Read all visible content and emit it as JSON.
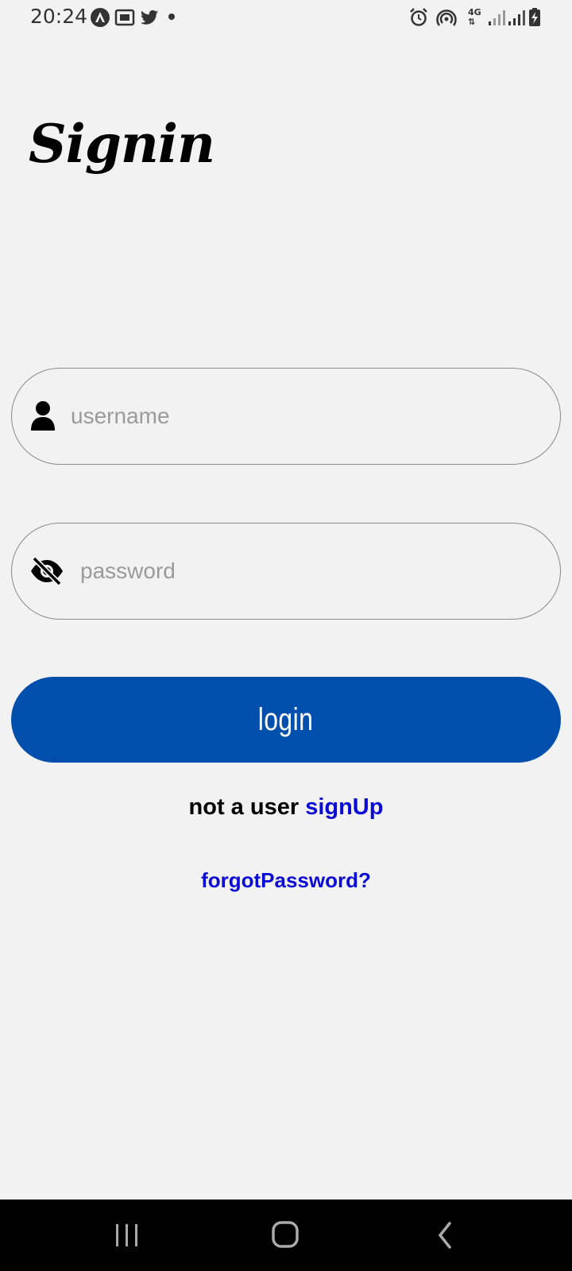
{
  "status_bar": {
    "time": "20:24",
    "left_icons": [
      "nav-app-icon",
      "cast-icon",
      "twitter-icon",
      "notification-dot"
    ],
    "right_icons": [
      "alarm-icon",
      "hotspot-icon",
      "4g-icon",
      "signal-icon",
      "signal-icon",
      "battery-charging-icon"
    ],
    "network_label": "4G"
  },
  "page": {
    "title": "Signin"
  },
  "form": {
    "username": {
      "placeholder": "username",
      "value": "",
      "icon": "user-icon"
    },
    "password": {
      "placeholder": "password",
      "value": "",
      "icon": "eye-off-icon"
    },
    "login_label": "login",
    "login_color": "#004fad"
  },
  "links": {
    "signup_prefix": "not a user",
    "signup_label": "signUp",
    "forgot_label": "forgotPassword?",
    "link_color": "#0a0ad6"
  },
  "nav_bar": {
    "buttons": [
      "recents-icon",
      "home-icon",
      "back-icon"
    ]
  }
}
